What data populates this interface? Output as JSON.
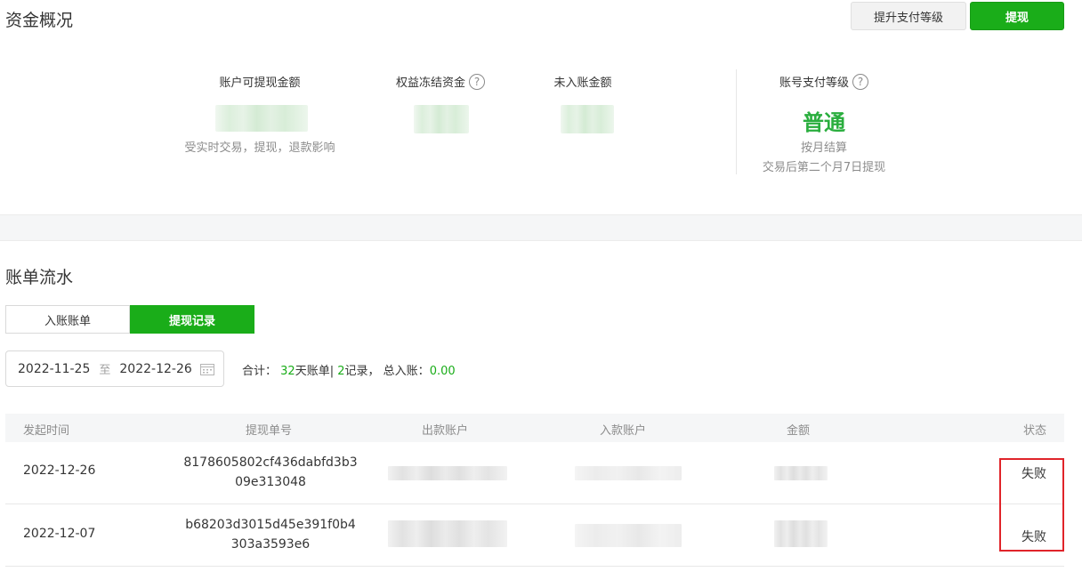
{
  "overview": {
    "title": "资金概况",
    "upgrade_button": "提升支付等级",
    "withdraw_button": "提现",
    "available": {
      "label": "账户可提现金额",
      "note": "受实时交易，提现，退款影响"
    },
    "frozen": {
      "label": "权益冻结资金",
      "help_icon": "?"
    },
    "pending": {
      "label": "未入账金额"
    },
    "pay_level": {
      "label": "账号支付等级",
      "help_icon": "?",
      "value": "普通",
      "settlement": "按月结算",
      "rule": "交易后第二个月7日提现"
    }
  },
  "bills": {
    "title": "账单流水",
    "tabs": [
      {
        "label": "入账账单",
        "active": false
      },
      {
        "label": "提现记录",
        "active": true
      }
    ],
    "date_range": {
      "start": "2022-11-25",
      "sep": "至",
      "end": "2022-12-26"
    },
    "summary": {
      "prefix": "合计：",
      "days": "32",
      "days_suffix": "天账单|",
      "records": "2",
      "records_suffix": "记录，",
      "total_label": "总入账：",
      "total": "0.00"
    },
    "columns": [
      "发起时间",
      "提现单号",
      "出款账户",
      "入款账户",
      "金额",
      "状态"
    ],
    "rows": [
      {
        "date": "2022-12-26",
        "order_no": "8178605802cf436dabfd3b309e313048",
        "status": "失败"
      },
      {
        "date": "2022-12-07",
        "order_no": "b68203d3015d45e391f0b4303a3593e6",
        "status": "失败"
      }
    ]
  },
  "colors": {
    "accent": "#1aad19",
    "level": "#2aae3e",
    "highlight": "#e0242a"
  }
}
